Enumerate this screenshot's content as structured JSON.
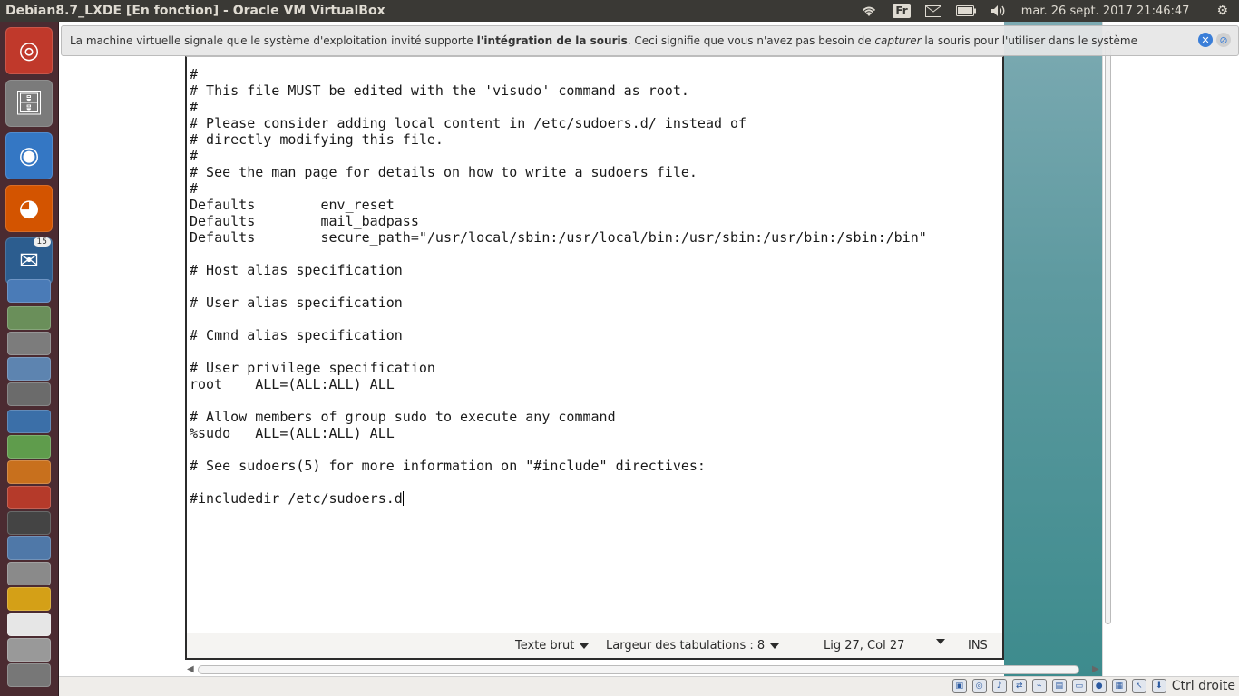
{
  "topbar": {
    "window_title": "Debian8.7_LXDE [En fonction] - Oracle VM VirtualBox",
    "keyboard_layout": "Fr",
    "clock": "mar. 26 sept. 2017 21:46:47"
  },
  "launcher": {
    "thunderbird_badge": "15"
  },
  "notification": {
    "text_before": "La machine virtuelle signale que le système d'exploitation invité supporte ",
    "text_bold": "l'intégration de la souris",
    "text_mid": ". Ceci signifie que vous n'avez pas besoin de ",
    "text_italic": "capturer",
    "text_after": " la souris pour l'utiliser dans le système"
  },
  "editor": {
    "lines": [
      "#",
      "# This file MUST be edited with the 'visudo' command as root.",
      "#",
      "# Please consider adding local content in /etc/sudoers.d/ instead of",
      "# directly modifying this file.",
      "#",
      "# See the man page for details on how to write a sudoers file.",
      "#",
      "Defaults        env_reset",
      "Defaults        mail_badpass",
      "Defaults        secure_path=\"/usr/local/sbin:/usr/local/bin:/usr/sbin:/usr/bin:/sbin:/bin\"",
      "",
      "# Host alias specification",
      "",
      "# User alias specification",
      "",
      "# Cmnd alias specification",
      "",
      "# User privilege specification",
      "root    ALL=(ALL:ALL) ALL",
      "",
      "# Allow members of group sudo to execute any command",
      "%sudo   ALL=(ALL:ALL) ALL",
      "",
      "# See sudoers(5) for more information on \"#include\" directives:",
      "",
      "#includedir /etc/sudoers.d"
    ],
    "status": {
      "syntax": "Texte brut",
      "tab_width": "Largeur des tabulations : 8",
      "position": "Lig 27, Col 27",
      "mode": "INS"
    }
  },
  "vbox_status": {
    "host_key": "Ctrl droite"
  },
  "colors": {
    "launcher_bg": "#4b2b31",
    "topbar_bg": "#3a3935",
    "desktop_teal": "#3d8b8d"
  }
}
